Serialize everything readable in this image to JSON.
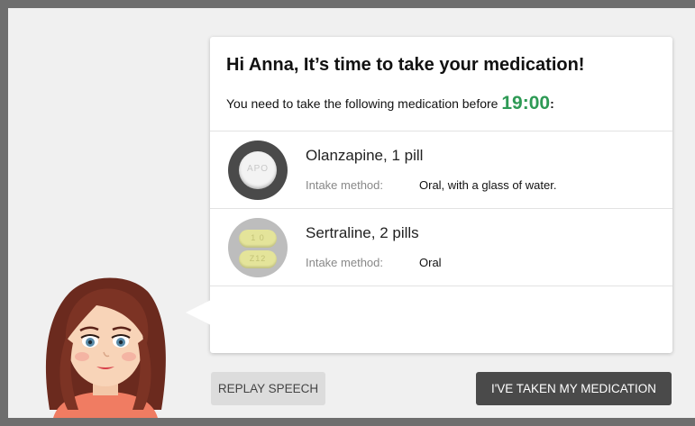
{
  "card": {
    "greeting": "Hi Anna, It’s time to take your medication!",
    "instruction": "You need to take the following medication before",
    "deadline": "19:00",
    "deadline_suffix": ":"
  },
  "medications": [
    {
      "name": "Olanzapine, 1 pill",
      "intake_label": "Intake method:",
      "intake_value": "Oral, with a glass of water.",
      "image_icon": "white-round-tablet",
      "imprint": "APO"
    },
    {
      "name": "Sertraline, 2 pills",
      "intake_label": "Intake method:",
      "intake_value": "Oral",
      "image_icon": "yellow-capsule-tablets",
      "imprint": [
        "1 0",
        "Z12"
      ]
    }
  ],
  "buttons": {
    "replay": "REPLAY SPEECH",
    "taken": "I'VE TAKEN MY MEDICATION"
  },
  "colors": {
    "accent_time": "#2e9a55",
    "primary_button": "#4a4a4a",
    "secondary_button": "#dcdcdc"
  }
}
